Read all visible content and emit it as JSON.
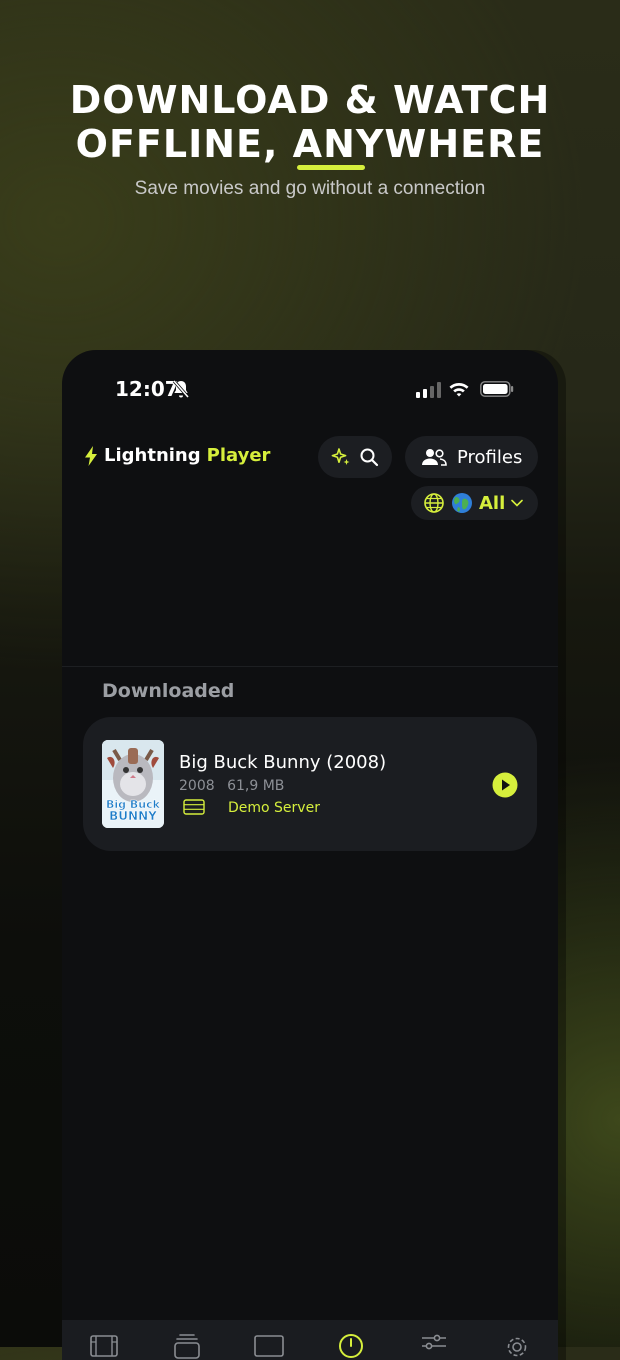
{
  "promo": {
    "headline_line1": "DOWNLOAD & WATCH",
    "headline_line2_part1": "OFFLINE, ",
    "headline_line2_accent": "AN",
    "headline_line2_part2": "YWHERE",
    "subtitle": "Save movies and go without a connection"
  },
  "statusbar": {
    "time": "12:07",
    "icons": [
      "bell-slash-icon",
      "cellular-signal-icon",
      "wifi-icon",
      "battery-icon"
    ]
  },
  "header": {
    "brand_word1": "Lightning",
    "brand_word2": "Player",
    "brand_icon": "lightning-bolt-icon",
    "search_icons": [
      "sparkle-icon",
      "search-icon"
    ],
    "profiles_label": "Profiles",
    "language_filter": {
      "icons": [
        "globe-outline-icon",
        "earth-globe-emoji"
      ],
      "value": "All"
    }
  },
  "downloads": {
    "section_title": "Downloaded",
    "items": [
      {
        "title": "Big Buck Bunny (2008)",
        "year": "2008",
        "size": "61,9 MB",
        "server": "Demo Server",
        "poster_text_line1": "Big Buck",
        "poster_text_line2": "BUNNY"
      }
    ]
  },
  "tabbar": {
    "tabs": [
      "film-icon",
      "layers-icon",
      "tv-icon",
      "downloads-clock-icon",
      "sliders-icon",
      "settings-gear-icon"
    ],
    "active_tab": "downloads-clock-icon"
  },
  "colors": {
    "accent": "#d6ef3c",
    "phone_bg": "#0e0f11",
    "card_bg": "#1b1d21"
  }
}
